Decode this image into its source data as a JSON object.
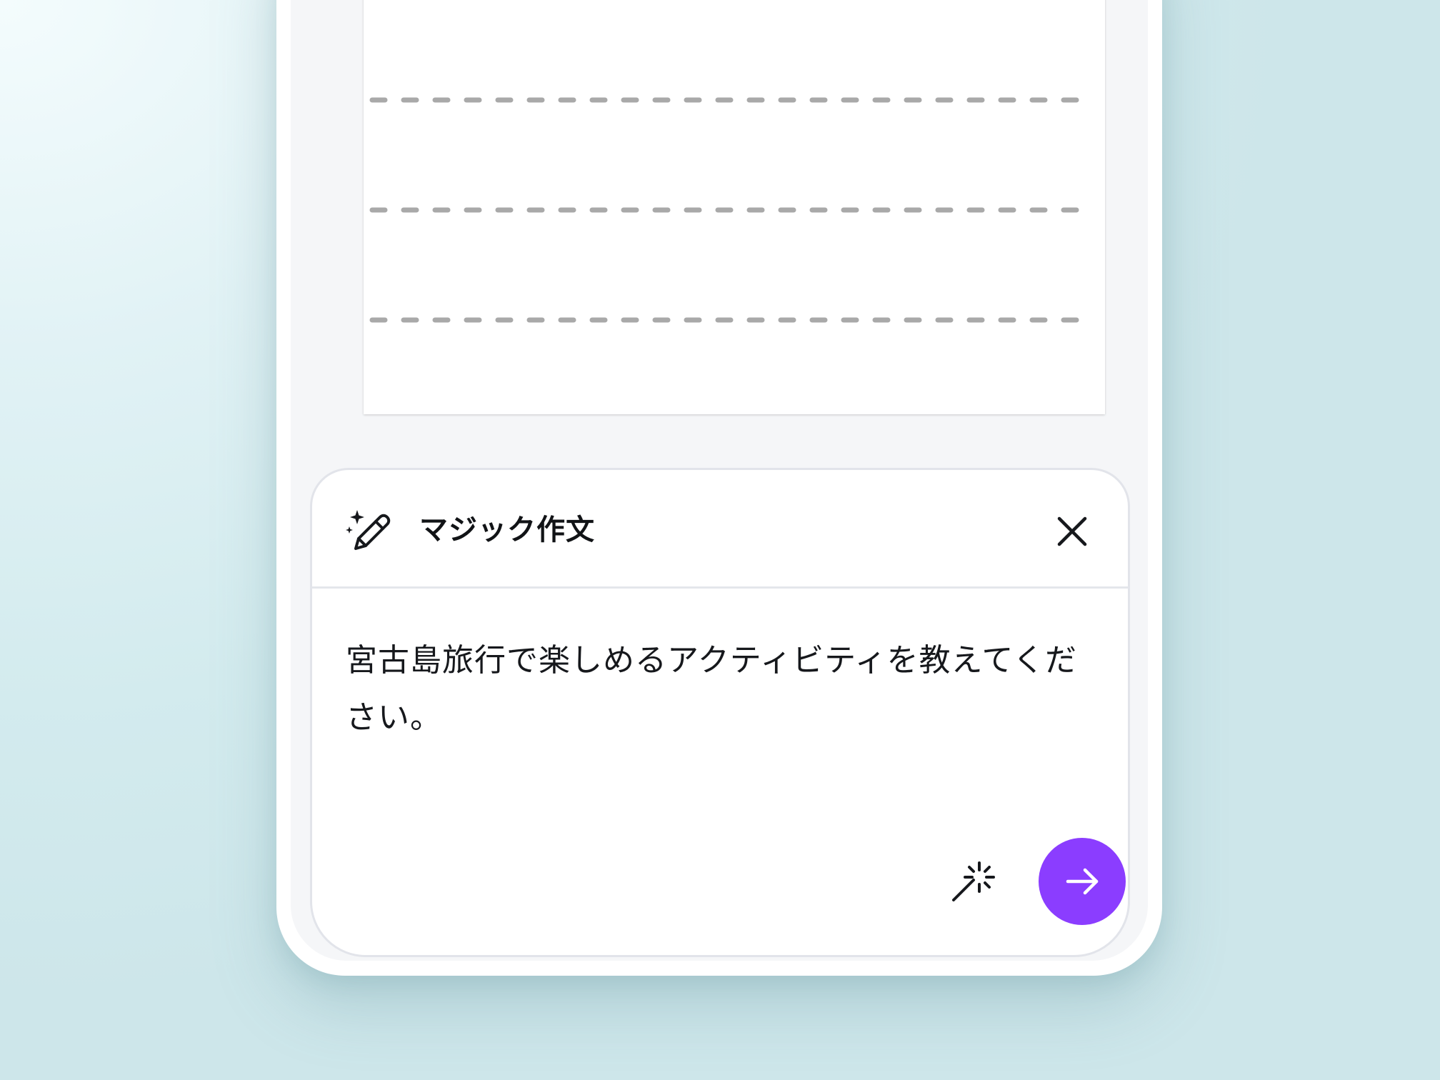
{
  "magic_write_panel": {
    "title": "マジック作文",
    "prompt_text": "宮古島旅行で楽しめるアクティビティを教えてください。",
    "icons": {
      "header": "magic-pencil-icon",
      "close": "close-icon",
      "wand": "magic-wand-icon",
      "send": "arrow-right-icon"
    }
  },
  "colors": {
    "send_button": "#8b3dff",
    "placeholder_lines": "#a8a8a8"
  }
}
